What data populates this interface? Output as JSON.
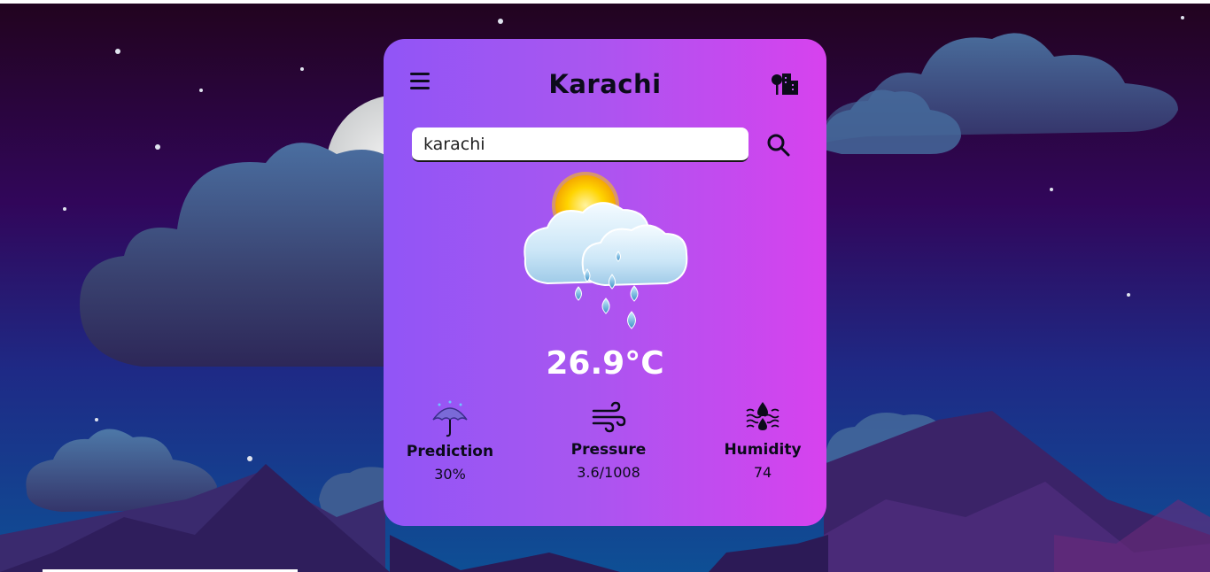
{
  "header": {
    "city": "Karachi"
  },
  "search": {
    "value": "karachi"
  },
  "current": {
    "temperature": "26.9°C",
    "condition_icon": "sun-cloud-rain-icon"
  },
  "stats": [
    {
      "icon": "umbrella-icon",
      "label": "Prediction",
      "value": "30%"
    },
    {
      "icon": "wind-icon",
      "label": "Pressure",
      "value": "3.6/1008"
    },
    {
      "icon": "humidity-icon",
      "label": "Humidity",
      "value": "74"
    }
  ],
  "colors": {
    "card_gradient_start": "#9155f6",
    "card_gradient_end": "#d742ee",
    "sky_top": "#22041f",
    "sky_bottom": "#0e4f95",
    "text_dark": "#0b0b1a",
    "text_light": "#ffffff"
  }
}
